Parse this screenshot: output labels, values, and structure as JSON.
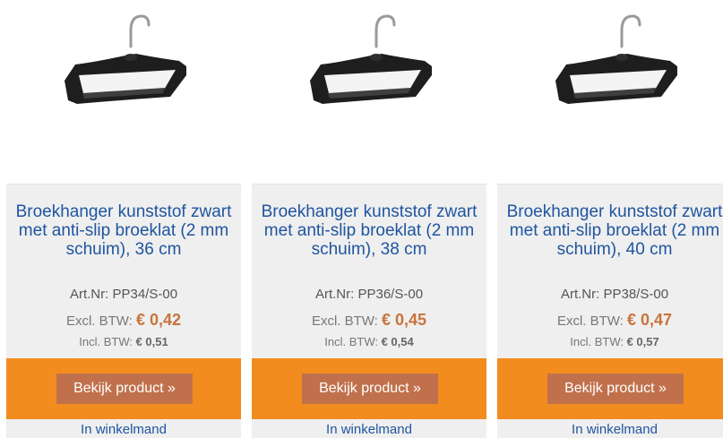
{
  "products": [
    {
      "title": "Broekhanger kunststof zwart met anti-slip broeklat (2 mm schuim), 36 cm",
      "art_label": "Art.Nr:",
      "art_nr": "PP34/S-00",
      "excl_label": "Excl. BTW:",
      "excl_price": "€ 0,42",
      "incl_label": "Incl. BTW:",
      "incl_price": "€ 0,51",
      "button_label": "Bekijk product »",
      "cart_label": "In winkelmand",
      "image_icon": "trouser-hanger-image"
    },
    {
      "title": "Broekhanger kunststof zwart met anti-slip broeklat (2 mm schuim), 38 cm",
      "art_label": "Art.Nr:",
      "art_nr": "PP36/S-00",
      "excl_label": "Excl. BTW:",
      "excl_price": "€ 0,45",
      "incl_label": "Incl. BTW:",
      "incl_price": "€ 0,54",
      "button_label": "Bekijk product »",
      "cart_label": "In winkelmand",
      "image_icon": "trouser-hanger-image"
    },
    {
      "title": "Broekhanger kunststof zwart met anti-slip broeklat (2 mm schuim), 40 cm",
      "art_label": "Art.Nr:",
      "art_nr": "PP38/S-00",
      "excl_label": "Excl. BTW:",
      "excl_price": "€ 0,47",
      "incl_label": "Incl. BTW:",
      "incl_price": "€ 0,57",
      "button_label": "Bekijk product »",
      "cart_label": "In winkelmand",
      "image_icon": "trouser-hanger-image"
    }
  ],
  "colors": {
    "title_blue": "#1f55a0",
    "price_orange": "#c8743c",
    "band_orange": "#f28c1e",
    "button_brown": "#c0714c",
    "card_gray": "#efefef"
  }
}
